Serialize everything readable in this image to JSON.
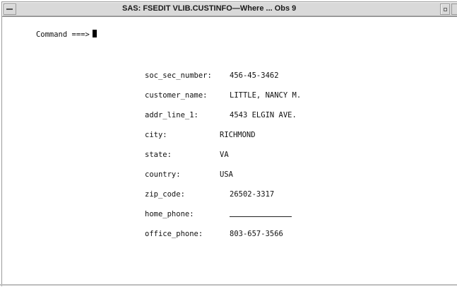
{
  "window": {
    "title": "SAS: FSEDIT VLIB.CUSTINFO—Where ... Obs 9"
  },
  "command": {
    "prompt": "Command ===>"
  },
  "fields": [
    {
      "label": "soc_sec_number:",
      "value": "456-45-3462"
    },
    {
      "label": "customer_name:",
      "value": "LITTLE, NANCY M."
    },
    {
      "label": "addr_line_1:",
      "value": "4543 ELGIN AVE."
    },
    {
      "label": "city:",
      "value": "RICHMOND"
    },
    {
      "label": "state:",
      "value": "VA"
    },
    {
      "label": "country:",
      "value": "USA"
    },
    {
      "label": "zip_code:",
      "value": "26502-3317"
    },
    {
      "label": "home_phone:",
      "value": ""
    },
    {
      "label": "office_phone:",
      "value": "803-657-3566"
    }
  ]
}
